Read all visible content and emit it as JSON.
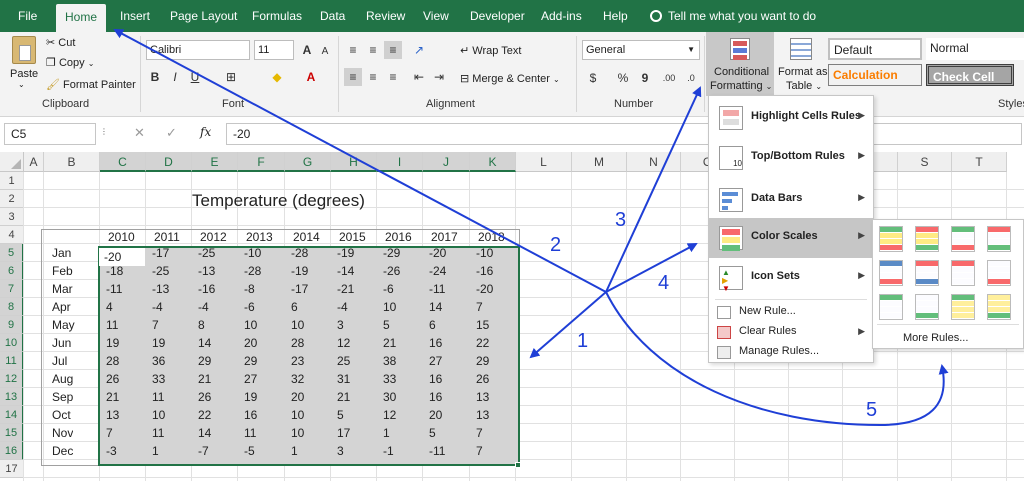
{
  "menu": {
    "tabs": [
      "File",
      "Home",
      "Insert",
      "Page Layout",
      "Formulas",
      "Data",
      "Review",
      "View",
      "Developer",
      "Add-ins",
      "Help"
    ],
    "tell_me": "Tell me what you want to do"
  },
  "ribbon": {
    "clipboard": {
      "paste": "Paste",
      "cut": "Cut",
      "copy": "Copy",
      "format_painter": "Format Painter",
      "label": "Clipboard"
    },
    "font": {
      "name": "Calibri",
      "size": "11",
      "label": "Font",
      "bold": "B",
      "italic": "I",
      "underline": "U",
      "grow": "A",
      "shrink": "A"
    },
    "alignment": {
      "wrap": "Wrap Text",
      "merge": "Merge & Center",
      "label": "Alignment"
    },
    "number": {
      "format": "General",
      "label": "Number",
      "currency": "$",
      "percent": "%",
      "comma": "9"
    },
    "styles": {
      "cond_line1": "Conditional",
      "cond_line2": "Formatting",
      "fat_line1": "Format as",
      "fat_line2": "Table",
      "default": "Default",
      "normal": "Normal",
      "calculation": "Calculation",
      "check_cell": "Check Cell",
      "label": "Styles"
    }
  },
  "formula_bar": {
    "cell": "C5",
    "value": "-20",
    "fx": "fx",
    "cancel": "✕",
    "enter": "✓"
  },
  "sheet": {
    "columns": [
      "A",
      "B",
      "C",
      "D",
      "E",
      "F",
      "G",
      "H",
      "I",
      "J",
      "K",
      "L",
      "M",
      "N",
      "O",
      "P",
      "Q",
      "R",
      "S",
      "T"
    ],
    "rows": [
      "1",
      "2",
      "3",
      "4",
      "5",
      "6",
      "7",
      "8",
      "9",
      "10",
      "11",
      "12",
      "13",
      "14",
      "15",
      "16",
      "17"
    ],
    "title": "Temperature (degrees)",
    "years": [
      "2010",
      "2011",
      "2012",
      "2013",
      "2014",
      "2015",
      "2016",
      "2017",
      "2018"
    ],
    "months": [
      "Jan",
      "Feb",
      "Mar",
      "Apr",
      "May",
      "Jun",
      "Jul",
      "Aug",
      "Sep",
      "Oct",
      "Nov",
      "Dec"
    ],
    "values": [
      [
        "-20",
        "-17",
        "-25",
        "-10",
        "-28",
        "-19",
        "-29",
        "-20",
        "-10"
      ],
      [
        "-18",
        "-25",
        "-13",
        "-28",
        "-19",
        "-14",
        "-26",
        "-24",
        "-16"
      ],
      [
        "-11",
        "-13",
        "-16",
        "-8",
        "-17",
        "-21",
        "-6",
        "-11",
        "-20"
      ],
      [
        "4",
        "-4",
        "-4",
        "-6",
        "6",
        "-4",
        "10",
        "14",
        "7"
      ],
      [
        "11",
        "7",
        "8",
        "10",
        "10",
        "3",
        "5",
        "6",
        "15"
      ],
      [
        "19",
        "19",
        "14",
        "20",
        "28",
        "12",
        "21",
        "16",
        "22"
      ],
      [
        "28",
        "36",
        "29",
        "29",
        "23",
        "25",
        "38",
        "27",
        "29"
      ],
      [
        "26",
        "33",
        "21",
        "27",
        "32",
        "31",
        "33",
        "16",
        "26"
      ],
      [
        "21",
        "11",
        "26",
        "19",
        "20",
        "21",
        "30",
        "16",
        "13"
      ],
      [
        "13",
        "10",
        "22",
        "16",
        "10",
        "5",
        "12",
        "20",
        "13"
      ],
      [
        "7",
        "11",
        "14",
        "11",
        "10",
        "17",
        "1",
        "5",
        "7"
      ],
      [
        "-3",
        "1",
        "-7",
        "-5",
        "1",
        "3",
        "-1",
        "-11",
        "7"
      ]
    ]
  },
  "cf_menu": {
    "items": [
      "Highlight Cells Rules",
      "Top/Bottom Rules",
      "Data Bars",
      "Color Scales",
      "Icon Sets"
    ],
    "small_items": [
      "New Rule...",
      "Clear Rules",
      "Manage Rules..."
    ],
    "more_rules": "More Rules..."
  },
  "annotations": [
    "1",
    "2",
    "3",
    "4",
    "5"
  ],
  "colors": {
    "excel_green": "#217346",
    "arrow_blue": "#1f3fd6",
    "highlight": "#c6c6c6"
  }
}
